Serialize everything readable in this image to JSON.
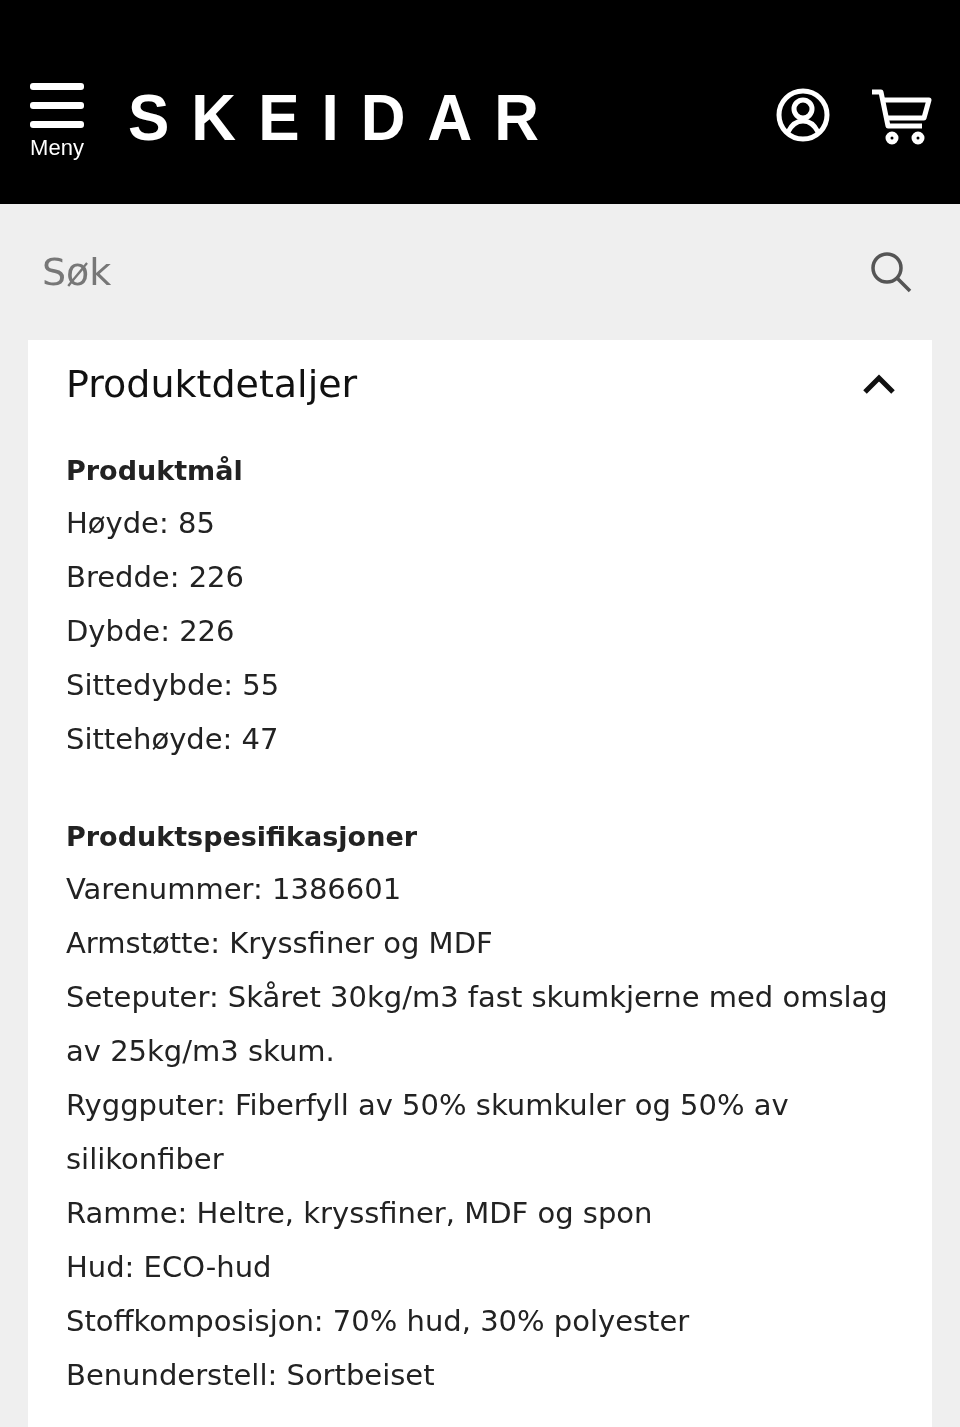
{
  "header": {
    "menu_label": "Meny",
    "logo": "SKEIDAR"
  },
  "search": {
    "placeholder": "Søk"
  },
  "details": {
    "title": "Produktdetaljer",
    "expanded": true,
    "sections": [
      {
        "heading": "Produktmål",
        "lines": [
          "Høyde: 85",
          "Bredde: 226",
          "Dybde: 226",
          "Sittedybde: 55",
          "Sittehøyde: 47"
        ]
      },
      {
        "heading": "Produktspesifikasjoner",
        "lines": [
          "Varenummer: 1386601",
          "Armstøtte: Kryssfiner og MDF",
          "Seteputer: Skåret 30kg/m3 fast skumkjerne med omslag av 25kg/m3 skum.",
          "Ryggputer: Fiberfyll av 50% skumkuler og 50% av silikonfiber",
          "Ramme: Heltre, kryssfiner, MDF og spon",
          "Hud: ECO-hud",
          "Stoffkomposisjon: 70% hud, 30% polyester",
          "Benunderstell: Sortbeiset"
        ]
      }
    ]
  }
}
